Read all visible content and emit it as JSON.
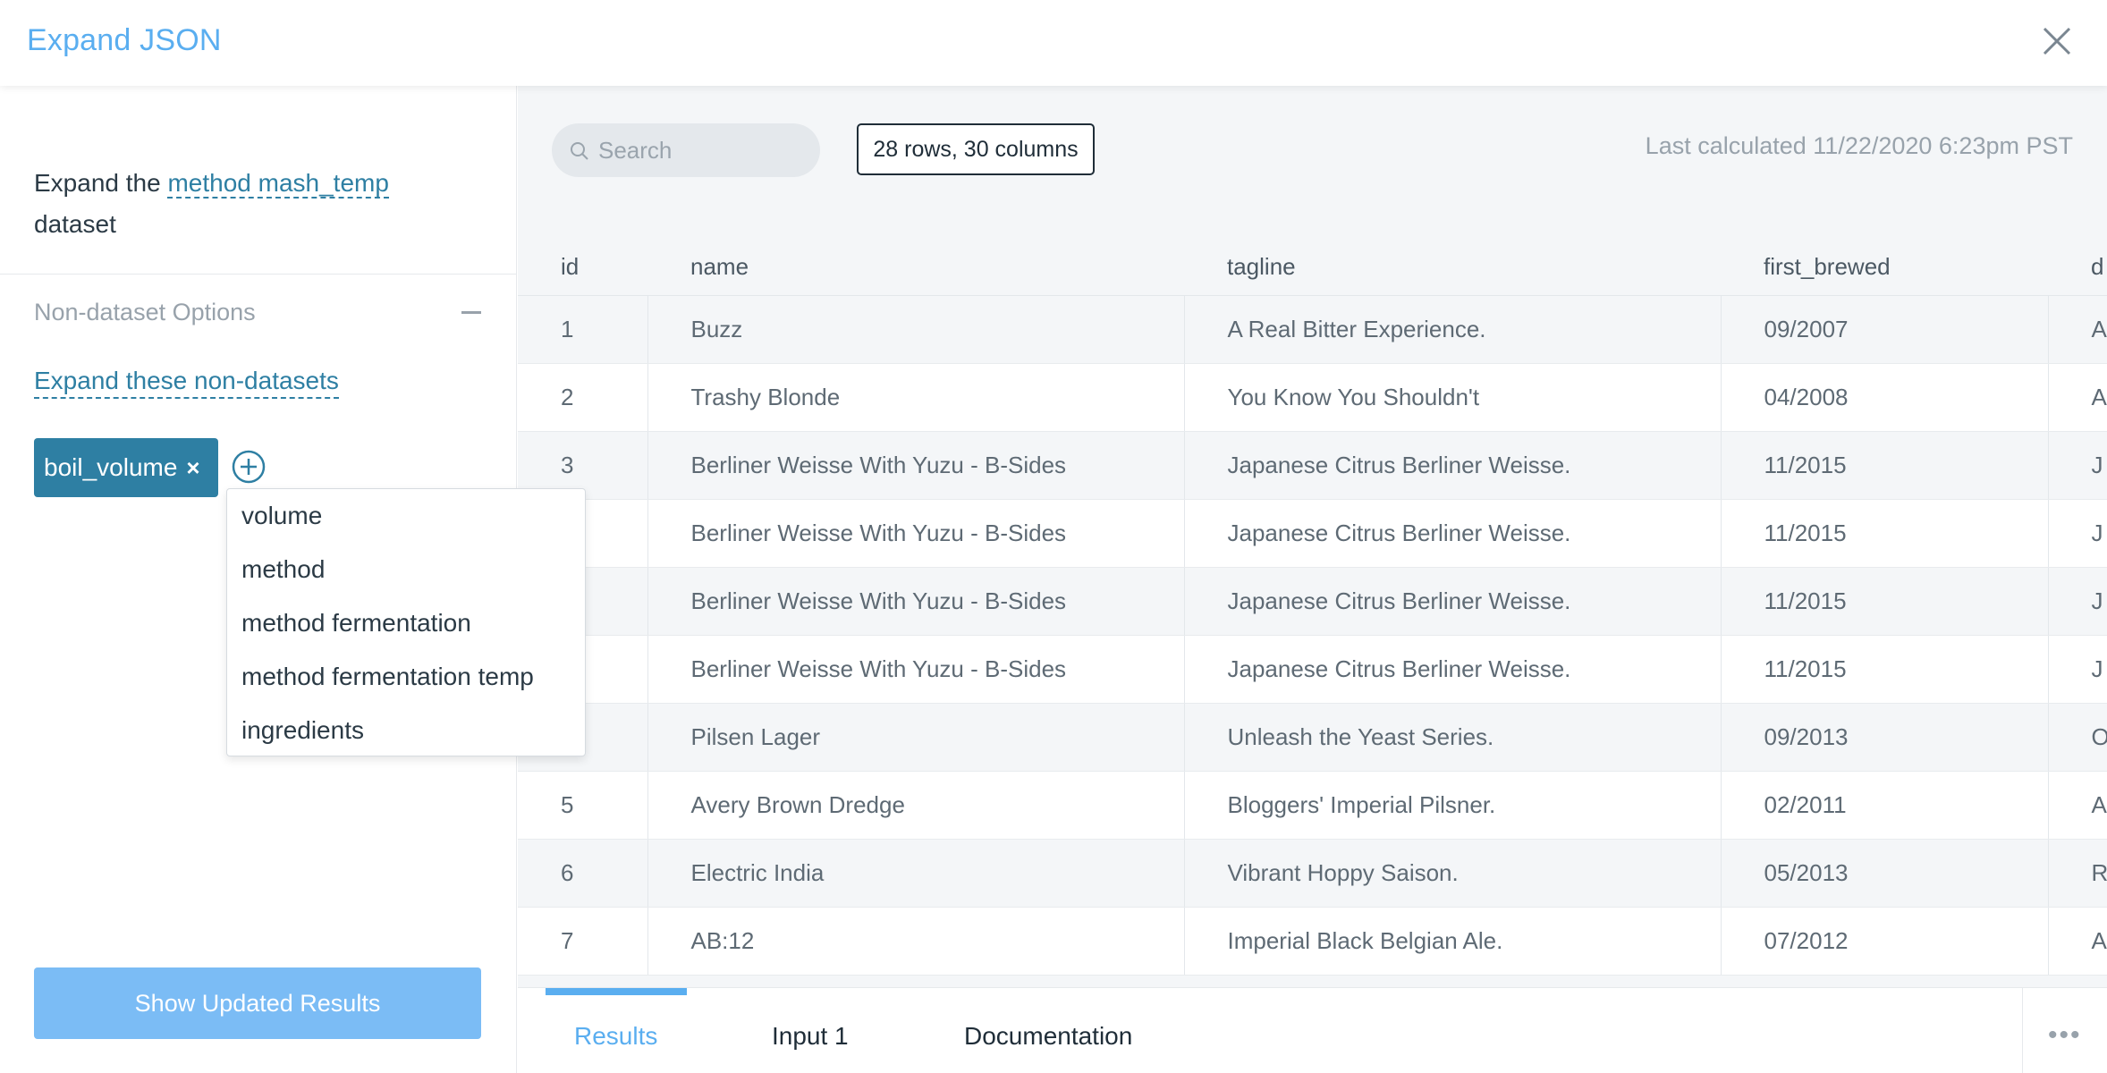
{
  "header": {
    "title": "Expand JSON",
    "close_icon": "close-icon"
  },
  "left": {
    "intro_prefix": "Expand the ",
    "dataset_link": "method mash_temp",
    "intro_suffix": "dataset",
    "section_title": "Non-dataset Options",
    "expand_link": "Expand these non-datasets",
    "tag_label": "boil_volume",
    "tag_remove": "×",
    "dropdown_options": [
      "volume",
      "method",
      "method fermentation",
      "method fermentation temp",
      "ingredients"
    ],
    "primary_button": "Show Updated Results"
  },
  "toolbar": {
    "search_placeholder": "Search",
    "rows_badge": "28 rows, 30 columns",
    "last_calculated": "Last calculated 11/22/2020 6:23pm PST"
  },
  "table": {
    "columns": [
      "id",
      "name",
      "tagline",
      "first_brewed",
      "d"
    ],
    "rows": [
      [
        "1",
        "Buzz",
        "A Real Bitter Experience.",
        "09/2007",
        "A"
      ],
      [
        "2",
        "Trashy Blonde",
        "You Know You Shouldn't",
        "04/2008",
        "A"
      ],
      [
        "3",
        "Berliner Weisse With Yuzu - B-Sides",
        "Japanese Citrus Berliner Weisse.",
        "11/2015",
        "J"
      ],
      [
        "",
        "Berliner Weisse With Yuzu - B-Sides",
        "Japanese Citrus Berliner Weisse.",
        "11/2015",
        "J"
      ],
      [
        "",
        "Berliner Weisse With Yuzu - B-Sides",
        "Japanese Citrus Berliner Weisse.",
        "11/2015",
        "J"
      ],
      [
        "",
        "Berliner Weisse With Yuzu - B-Sides",
        "Japanese Citrus Berliner Weisse.",
        "11/2015",
        "J"
      ],
      [
        "",
        "Pilsen Lager",
        "Unleash the Yeast Series.",
        "09/2013",
        "O"
      ],
      [
        "5",
        "Avery Brown Dredge",
        "Bloggers' Imperial Pilsner.",
        "02/2011",
        "A"
      ],
      [
        "6",
        "Electric India",
        "Vibrant Hoppy Saison.",
        "05/2013",
        "R"
      ],
      [
        "7",
        "AB:12",
        "Imperial Black Belgian Ale.",
        "07/2012",
        "A"
      ]
    ]
  },
  "tabs": {
    "items": [
      "Results",
      "Input 1",
      "Documentation"
    ],
    "active": "Results",
    "more": "•••"
  },
  "colors": {
    "accent": "#5aaef0",
    "link": "#2e7fa3",
    "primary_button": "#7bbcf5"
  }
}
